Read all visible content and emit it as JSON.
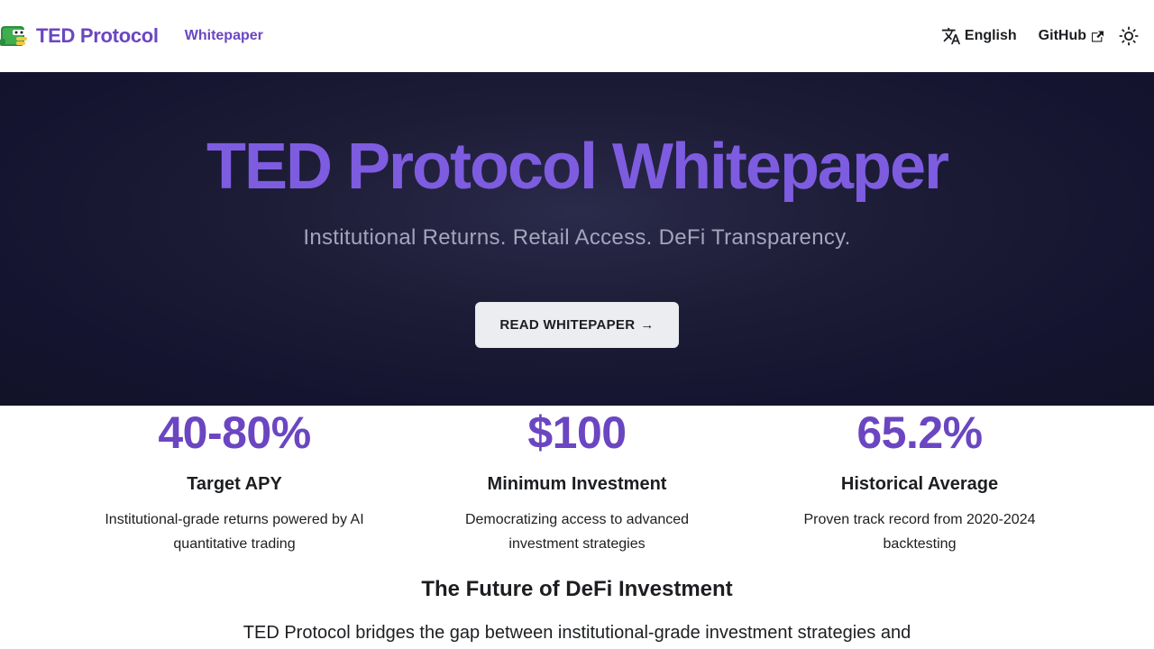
{
  "navbar": {
    "brand_title": "TED Protocol",
    "whitepaper_link": "Whitepaper",
    "language_label": "English",
    "github_label": "GitHub"
  },
  "hero": {
    "title": "TED Protocol Whitepaper",
    "subtitle": "Institutional Returns. Retail Access. DeFi Transparency.",
    "cta_label": "READ WHITEPAPER",
    "cta_arrow": "→"
  },
  "stats": [
    {
      "value": "40-80%",
      "label": "Target APY",
      "description": "Institutional-grade returns powered by AI quantitative trading"
    },
    {
      "value": "$100",
      "label": "Minimum Investment",
      "description": "Democratizing access to advanced investment strategies"
    },
    {
      "value": "65.2%",
      "label": "Historical Average",
      "description": "Proven track record from 2020-2024 backtesting"
    }
  ],
  "future": {
    "title": "The Future of DeFi Investment",
    "text": "TED Protocol bridges the gap between institutional-grade investment strategies and"
  },
  "colors": {
    "brand": "#6b46c1",
    "hero_title": "#7e5ce0",
    "hero_bg": "#161630",
    "button_bg": "#ebedf0"
  },
  "icons": {
    "logo": "dinosaur-logo-icon",
    "language": "translate-icon",
    "external": "external-link-icon",
    "theme": "sun-icon"
  }
}
